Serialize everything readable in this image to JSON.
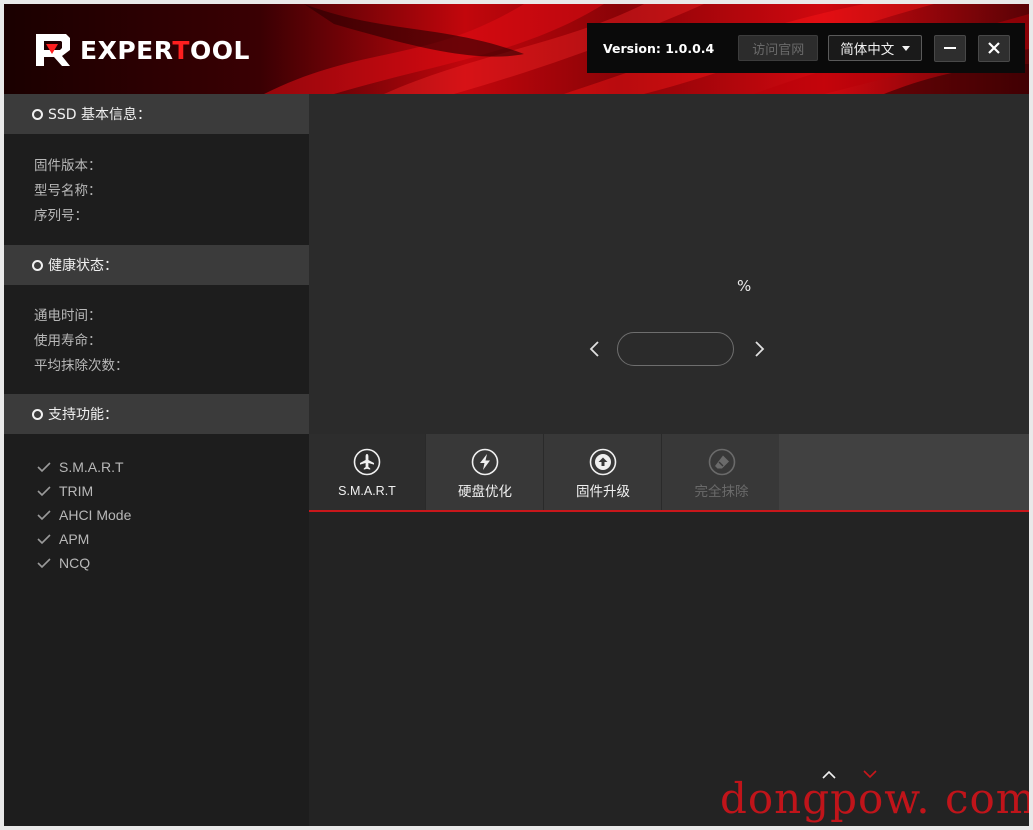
{
  "header": {
    "brand_prefix": "EXPER",
    "brand_accent": "T",
    "brand_suffix": "OOL",
    "version": "Version: 1.0.0.4",
    "visit_label": "访问官网",
    "language": "简体中文",
    "minimize_icon": "minimize-icon",
    "close_icon": "close-icon"
  },
  "sidebar": {
    "ssd_info": {
      "title": "SSD 基本信息：",
      "firmware": "固件版本：",
      "model": "型号名称：",
      "serial": "序列号："
    },
    "health": {
      "title": "健康状态：",
      "power_on": "通电时间：",
      "lifespan": "使用寿命：",
      "erase_count": "平均抹除次数："
    },
    "features": {
      "title": "支持功能：",
      "items": [
        "S.M.A.R.T",
        "TRIM",
        "AHCI Mode",
        "APM",
        "NCQ"
      ]
    }
  },
  "main": {
    "health_percent_unit": "%",
    "tabs": [
      {
        "label": "S.M.A.R.T",
        "icon": "airplane-icon",
        "active": true
      },
      {
        "label": "硬盘优化",
        "icon": "lightning-icon"
      },
      {
        "label": "固件升级",
        "icon": "upload-arrow-icon"
      },
      {
        "label": "完全抹除",
        "icon": "eraser-icon",
        "disabled": true
      }
    ]
  },
  "watermark": "dongpow. com",
  "colors": {
    "accent": "#c9171b",
    "background": "#232323",
    "sidebar": "#1d1d1d",
    "section_header": "#3b3b3b"
  }
}
